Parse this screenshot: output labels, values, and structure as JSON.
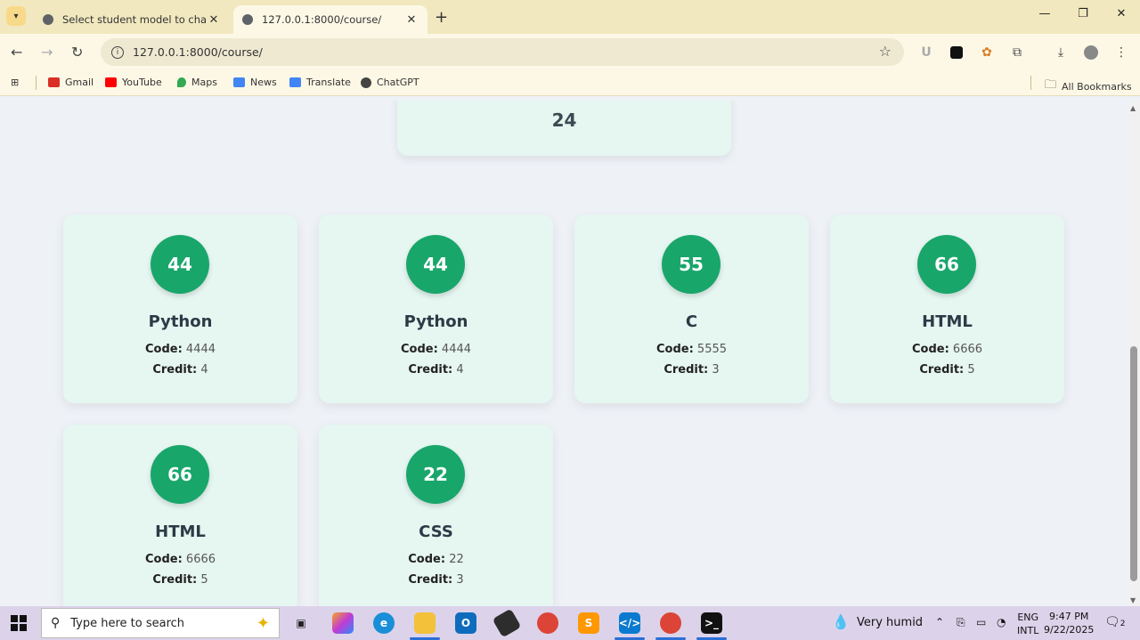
{
  "browser": {
    "tabs": [
      {
        "title": "Select student model to change",
        "active": false
      },
      {
        "title": "127.0.0.1:8000/course/",
        "active": true
      }
    ],
    "url": "127.0.0.1:8000/course/",
    "bookmarks": [
      "Gmail",
      "YouTube",
      "Maps",
      "News",
      "Translate",
      "ChatGPT"
    ],
    "all_bookmarks_label": "All Bookmarks"
  },
  "page": {
    "top_card_value": "24",
    "code_label": "Code:",
    "credit_label": "Credit:",
    "courses": [
      {
        "number": "44",
        "name": "Python",
        "code": "4444",
        "credit": "4"
      },
      {
        "number": "44",
        "name": "Python",
        "code": "4444",
        "credit": "4"
      },
      {
        "number": "55",
        "name": "C",
        "code": "5555",
        "credit": "3"
      },
      {
        "number": "66",
        "name": "HTML",
        "code": "6666",
        "credit": "5"
      },
      {
        "number": "66",
        "name": "HTML",
        "code": "6666",
        "credit": "5"
      },
      {
        "number": "22",
        "name": "CSS",
        "code": "22",
        "credit": "3"
      }
    ]
  },
  "taskbar": {
    "search_placeholder": "Type here to search",
    "weather": "Very humid",
    "lang_line1": "ENG",
    "lang_line2": "INTL",
    "time": "9:47 PM",
    "date": "9/22/2025",
    "notification_count": "2"
  },
  "colors": {
    "accent_green": "#19a66b",
    "card_bg": "#e6f6f1",
    "page_bg": "#eef2f7"
  }
}
